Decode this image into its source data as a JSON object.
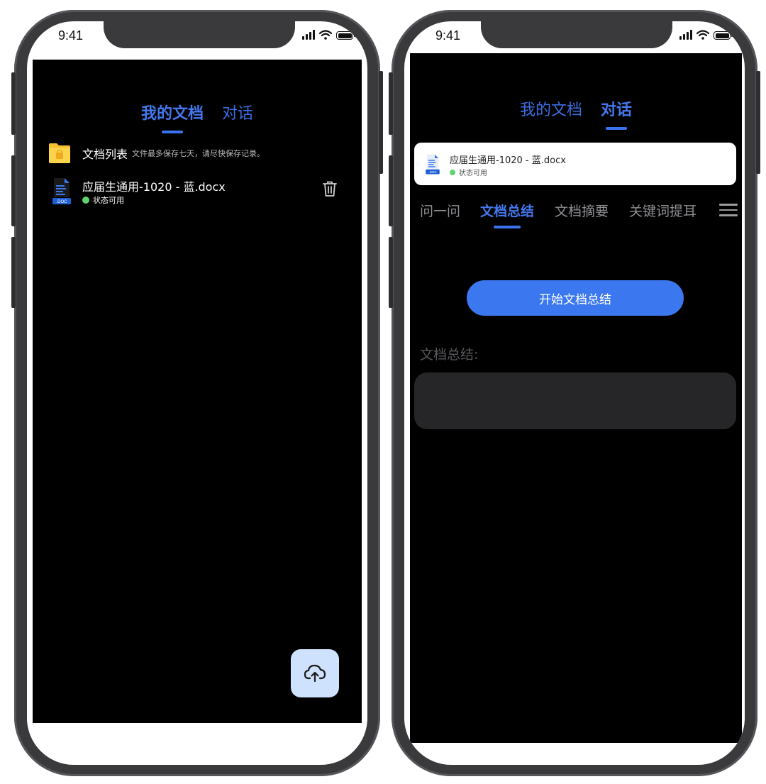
{
  "left_phone": {
    "status_bar": {
      "time": "9:41"
    },
    "tabs": [
      {
        "label": "我的文档",
        "active": true
      },
      {
        "label": "对话",
        "active": false
      }
    ],
    "folder": {
      "title": "文档列表",
      "note": "文件最多保存七天，请尽快保存记录。"
    },
    "document": {
      "name": "应届生通用-1020 - 蓝.docx",
      "status": "状态可用",
      "icon_label": ".DOC"
    },
    "upload_icon": "cloud-upload-icon"
  },
  "right_phone": {
    "status_bar": {
      "time": "9:41"
    },
    "tabs": [
      {
        "label": "我的文档",
        "active": false
      },
      {
        "label": "对话",
        "active": true
      }
    ],
    "document": {
      "name": "应届生通用-1020 - 蓝.docx",
      "status": "状态可用",
      "icon_label": ".DOC"
    },
    "sub_tabs": [
      {
        "label": "问一问",
        "active": false
      },
      {
        "label": "文档总结",
        "active": true
      },
      {
        "label": "文档摘要",
        "active": false
      },
      {
        "label": "关键词提耳",
        "active": false
      }
    ],
    "start_button": "开始文档总结",
    "result_label": "文档总结:",
    "result_text": ""
  },
  "colors": {
    "accent": "#3b78f0",
    "tab_active": "#4578ee",
    "status_green": "#5fd46e",
    "folder_yellow": "#f7c12e",
    "upload_bg": "#cfe2fd",
    "app_background": "#000000",
    "result_box": "#262628"
  }
}
